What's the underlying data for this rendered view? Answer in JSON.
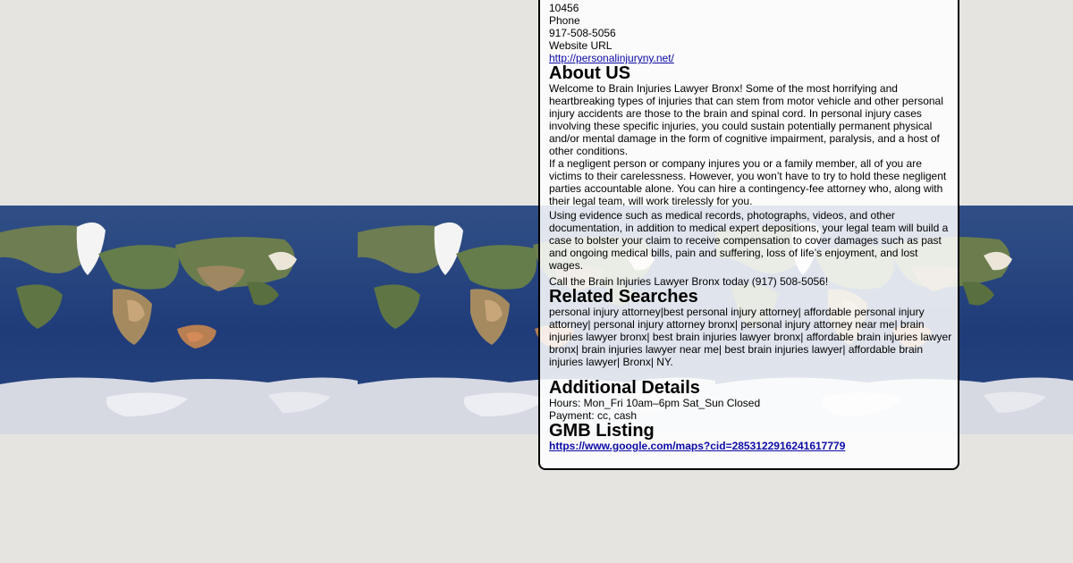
{
  "listing": {
    "zip": "10456",
    "phone_label": "Phone",
    "phone": "917-508-5056",
    "website_label": "Website URL",
    "website_url": "http://personalinjuryny.net/"
  },
  "about": {
    "title": "About US",
    "paragraphs": [
      "Welcome to Brain Injuries Lawyer Bronx! Some of the most horrifying and heartbreaking types of injuries that can stem from motor vehicle and other personal injury accidents are those to the brain  and spinal cord. In personal injury cases involving these specific injuries, you could sustain potentially permanent physical and/or mental damage in the form of cognitive impairment, paralysis, and a host of other conditions.",
      "If a negligent person or company injures you or a family member, all of you are victims to their carelessness. However, you won’t have to try to hold these negligent parties accountable alone. You can hire a contingency-fee attorney who, along with their legal team, will work tirelessly for you.",
      "Using evidence such as medical records, photographs, videos, and other documentation, in addition to medical expert depositions, your legal team will build a case to bolster your claim to receive compensation to cover damages such as past and ongoing medical bills, pain and suffering, loss of life’s enjoyment, and lost wages.",
      "Call the Brain Injuries Lawyer Bronx today (917) 508-5056!"
    ]
  },
  "related": {
    "title": "Related Searches",
    "text": "personal injury attorney|best personal injury attorney| affordable personal injury attorney| personal injury attorney bronx| personal injury attorney near me| brain injuries lawyer bronx| best brain injuries lawyer bronx| affordable brain injuries lawyer bronx| brain injuries lawyer near me| best brain injuries lawyer| affordable brain injuries lawyer| Bronx| NY."
  },
  "details": {
    "title": "Additional Details",
    "hours": "Hours: Mon_Fri 10am–6pm Sat_Sun Closed",
    "payment": "Payment: cc, cash"
  },
  "gmb": {
    "title": "GMB Listing",
    "url": "https://www.google.com/maps?cid=2853122916241617779"
  },
  "colors": {
    "page_background": "#e5e4e0",
    "ocean": "#1d3a78",
    "link": "#0a0aa6"
  }
}
